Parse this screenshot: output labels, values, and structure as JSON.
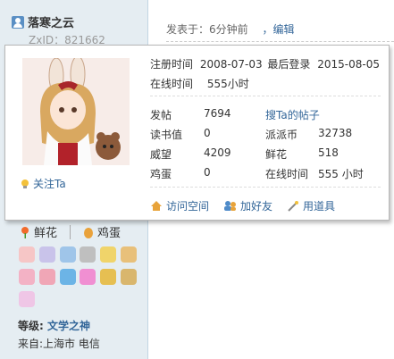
{
  "user": {
    "name": "落寒之云",
    "zxid": "ZxID：821662"
  },
  "post": {
    "posted_prefix": "发表于：6分钟前",
    "edit_link": "，编辑"
  },
  "card": {
    "reg_label": "注册时间",
    "reg_value": "2008-07-03",
    "last_label": "最后登录",
    "last_value": "2015-08-05",
    "online_label": "在线时间",
    "online_value": "555小时",
    "stats": [
      {
        "label": "发帖",
        "value": "7694"
      },
      {
        "label": "读书值",
        "value": "0"
      },
      {
        "label": "威望",
        "value": "4209"
      },
      {
        "label": "鸡蛋",
        "value": "0"
      }
    ],
    "stats_right": [
      {
        "label": "派派币",
        "value": "32738"
      },
      {
        "label": "鲜花",
        "value": "518"
      },
      {
        "label": "在线时间",
        "value": "555 小时"
      }
    ],
    "search_posts": "搜Ta的帖子",
    "follow": "关注Ta",
    "actions": [
      "访问空间",
      "加好友",
      "用道具"
    ]
  },
  "sidebar": {
    "flower": "鲜花",
    "egg": "鸡蛋",
    "level_label": "等级:",
    "level_value": "文学之神",
    "from": "来自:上海市 电信"
  },
  "colors": {
    "link": "#336699",
    "sidebar_bg": "#e5edf2",
    "border": "#c2d5e3"
  }
}
